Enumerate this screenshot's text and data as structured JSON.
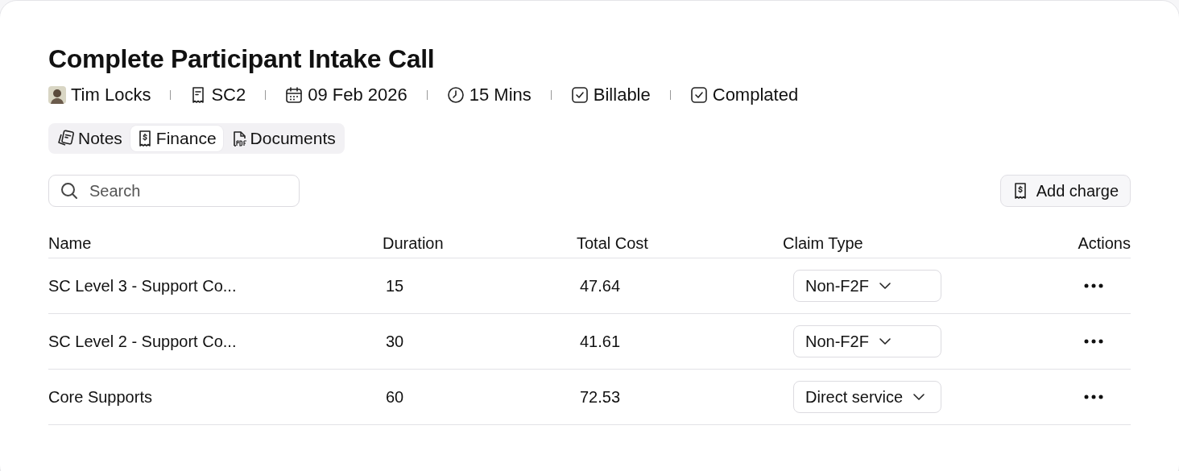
{
  "title": "Complete Participant Intake Call",
  "meta": [
    {
      "kind": "avatar",
      "text": "Tim Locks"
    },
    {
      "kind": "receipt",
      "text": "SC2"
    },
    {
      "kind": "calendar",
      "text": "09 Feb 2026"
    },
    {
      "kind": "clock",
      "text": "15 Mins"
    },
    {
      "kind": "check",
      "text": "Billable"
    },
    {
      "kind": "check",
      "text": "Complated"
    }
  ],
  "tabs": [
    {
      "kind": "notes",
      "label": "Notes",
      "selected": false
    },
    {
      "kind": "finance",
      "label": "Finance",
      "selected": true
    },
    {
      "kind": "pdf",
      "label": "Documents",
      "selected": false
    }
  ],
  "search": {
    "placeholder": "Search"
  },
  "add_button": "Add charge",
  "table": {
    "columns": [
      "Name",
      "Duration",
      "Total Cost",
      "Claim Type",
      "Actions"
    ],
    "rows": [
      {
        "name": "SC Level 3 - Support Co...",
        "duration": "15",
        "total_cost": "47.64",
        "claim_type": "Non-F2F"
      },
      {
        "name": "SC Level 2 - Support Co...",
        "duration": "30",
        "total_cost": "41.61",
        "claim_type": "Non-F2F"
      },
      {
        "name": "Core Supports",
        "duration": "60",
        "total_cost": "72.53",
        "claim_type": "Direct service"
      }
    ]
  }
}
